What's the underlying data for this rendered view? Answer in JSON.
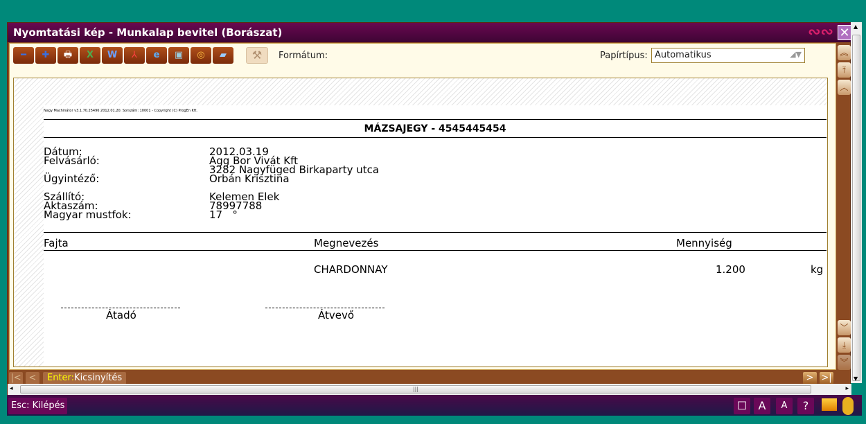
{
  "window": {
    "title": "Nyomtatási kép - Munkalap bevitel (Borászat)"
  },
  "toolbar": {
    "format_label": "Formátum:",
    "paper_label": "Papírtípus:",
    "paper_value": "Automatikus"
  },
  "document": {
    "header_line": "Nagy Machinátor v3.1.70.25496 2012.01.20. Sorszám: 10001 - Copyright (C) ProgEn Kft.",
    "title": "MÁZSAJEGY - 4545445454",
    "fields": [
      {
        "label": "Dátum:",
        "value": "2012.03.19"
      },
      {
        "label": "Felvásárló:",
        "value": "Agg Bor Vivát Kft"
      },
      {
        "label": "",
        "value": "3282 Nagyfüged Birkaparty utca"
      },
      {
        "label": "Ügyintéző:",
        "value": "Orbán Krisztina"
      },
      {
        "label": "Szállító:",
        "value": "Kelemen Elek"
      },
      {
        "label": "Aktaszám:",
        "value": "78997788"
      },
      {
        "label": "Magyar mustfok:",
        "value": "17   °"
      }
    ],
    "columns": [
      "Fajta",
      "Megnevezés",
      "Mennyiség"
    ],
    "rows": [
      {
        "fajta": "",
        "megnevezes": "CHARDONNAY",
        "mennyiseg": "1.200",
        "unit": "kg"
      }
    ],
    "sign_left": "Átadó",
    "sign_right": "Átvevő"
  },
  "nav": {
    "enter_key": "Enter:",
    "enter_label": "Kicsinyítés"
  },
  "footer": {
    "esc_label": "Esc: Kilépés"
  }
}
